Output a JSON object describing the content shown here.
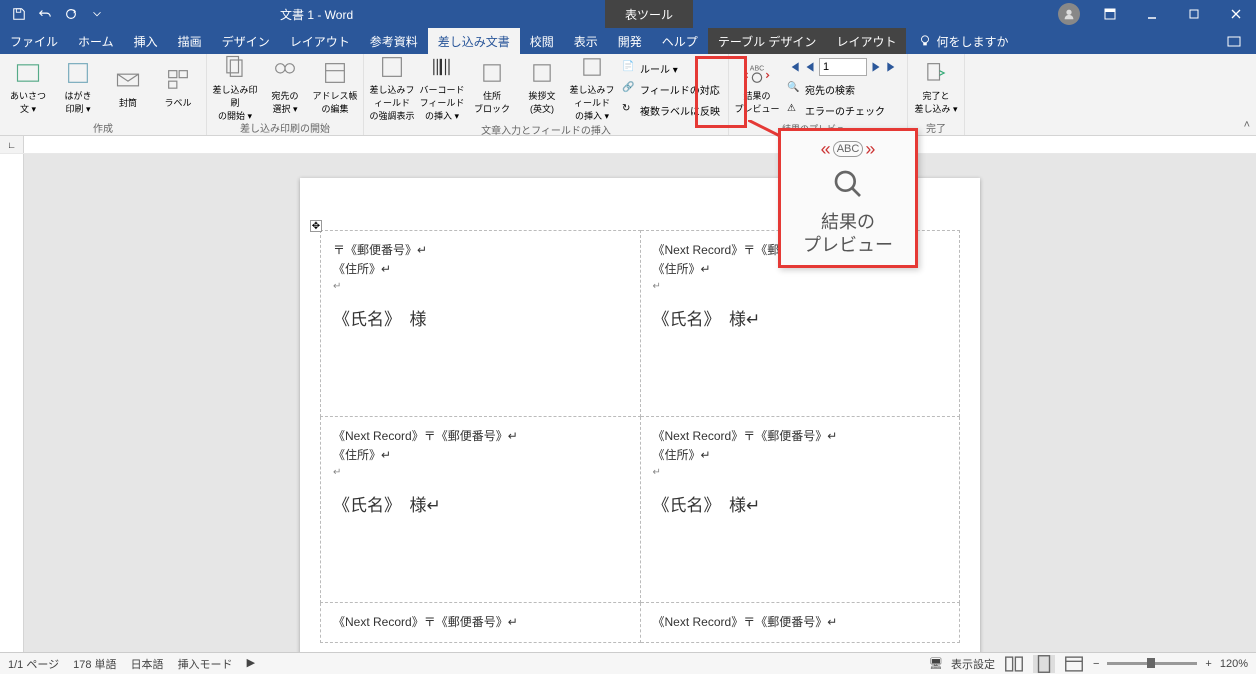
{
  "titlebar": {
    "document_title": "文書 1 - Word",
    "tool_context": "表ツール"
  },
  "tabs": {
    "file": "ファイル",
    "home": "ホーム",
    "insert": "挿入",
    "draw": "描画",
    "design": "デザイン",
    "layout": "レイアウト",
    "references": "参考資料",
    "mailings": "差し込み文書",
    "review": "校閲",
    "view": "表示",
    "developer": "開発",
    "help": "ヘルプ",
    "table_design": "テーブル デザイン",
    "table_layout": "レイアウト",
    "tell_me": "何をしますか"
  },
  "ribbon": {
    "group_create": "作成",
    "greeting": "あいさつ\n文 ▾",
    "postcard": "はがき\n印刷 ▾",
    "envelope": "封筒",
    "label": "ラベル",
    "group_start": "差し込み印刷の開始",
    "start_merge": "差し込み印刷\nの開始 ▾",
    "select_recipients": "宛先の\n選択 ▾",
    "edit_recipients": "アドレス帳\nの編集",
    "group_write": "文章入力とフィールドの挿入",
    "highlight_fields": "差し込みフィールド\nの強調表示",
    "barcode": "バーコード\nフィールドの挿入 ▾",
    "address_block": "住所\nブロック",
    "greeting_line": "挨拶文\n(英文)",
    "insert_field": "差し込みフィールド\nの挿入 ▾",
    "rules": "ルール ▾",
    "match_fields": "フィールドの対応",
    "update_labels": "複数ラベルに反映",
    "group_preview": "結果のプレビュー",
    "preview_results": "結果の\nプレビュー",
    "find_recipient": "宛先の検索",
    "check_errors": "エラーのチェック",
    "record_number": "1",
    "group_finish": "完了",
    "finish_merge": "完了と\n差し込み ▾"
  },
  "callout": {
    "line1": "結果の",
    "line2": "プレビュー"
  },
  "document": {
    "cell1": {
      "line1": "〒《郵便番号》↵",
      "line2": "《住所》↵",
      "blank": "↵",
      "name": "《氏名》　様"
    },
    "cell2": {
      "line1": "《Next Record》〒《郵便番",
      "line2": "《住所》↵",
      "blank": "↵",
      "name": "《氏名》　様↵"
    },
    "cell3": {
      "line1": "《Next Record》〒《郵便番号》↵",
      "line2": "《住所》↵",
      "blank": "↵",
      "name": "《氏名》　様↵"
    },
    "cell4": {
      "line1": "《Next Record》〒《郵便番号》↵",
      "line2": "《住所》↵",
      "blank": "↵",
      "name": "《氏名》　様↵"
    },
    "cell5": {
      "line1": "《Next Record》〒《郵便番号》↵"
    },
    "cell6": {
      "line1": "《Next Record》〒《郵便番号》↵"
    }
  },
  "statusbar": {
    "page": "1/1 ページ",
    "words": "178 単語",
    "language": "日本語",
    "insert_mode": "挿入モード",
    "display_settings": "表示設定",
    "zoom": "120%"
  }
}
